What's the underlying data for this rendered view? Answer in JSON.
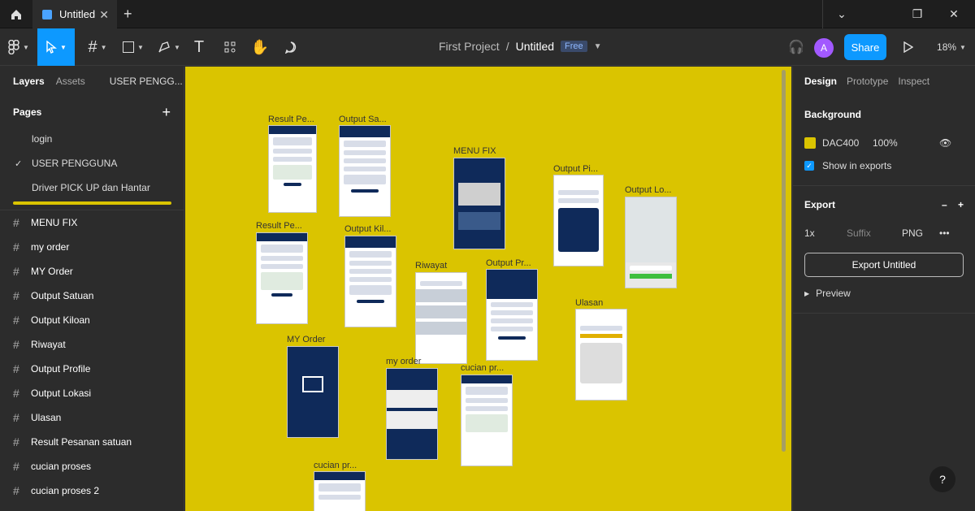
{
  "tab": {
    "title": "Untitled"
  },
  "toolbar": {
    "project": "First Project",
    "separator": "/",
    "file": "Untitled",
    "plan_badge": "Free",
    "share_label": "Share",
    "avatar_initial": "A",
    "zoom": "18%"
  },
  "left": {
    "tabs": [
      "Layers",
      "Assets"
    ],
    "current_page_short": "USER PENGG...",
    "pages_label": "Pages",
    "pages": [
      {
        "label": "login",
        "checked": false
      },
      {
        "label": "USER PENGGUNA",
        "checked": true
      },
      {
        "label": "Driver PICK UP dan Hantar",
        "checked": false
      }
    ],
    "layers": [
      "MENU FIX",
      "my order",
      "MY Order",
      "Output Satuan",
      "Output Kiloan",
      "Riwayat",
      "Output Profile",
      "Output Lokasi",
      "Ulasan",
      "Result Pesanan satuan",
      "cucian proses",
      "cucian proses 2"
    ]
  },
  "canvas": {
    "background": "#DAC400",
    "frame_labels": [
      "Result Pe...",
      "Output Sa...",
      "MENU FIX",
      "Output Pi...",
      "Output Lo...",
      "Result Pe...",
      "Output Kil...",
      "Riwayat",
      "Output Pr...",
      "Ulasan",
      "MY Order",
      "my order",
      "cucian pr...",
      "cucian pr..."
    ]
  },
  "right": {
    "tabs": [
      "Design",
      "Prototype",
      "Inspect"
    ],
    "background_label": "Background",
    "bg_hex": "DAC400",
    "bg_opacity": "100%",
    "show_exports": "Show in exports",
    "export_label": "Export",
    "scale": "1x",
    "suffix_placeholder": "Suffix",
    "format": "PNG",
    "export_button": "Export Untitled",
    "preview": "Preview"
  }
}
